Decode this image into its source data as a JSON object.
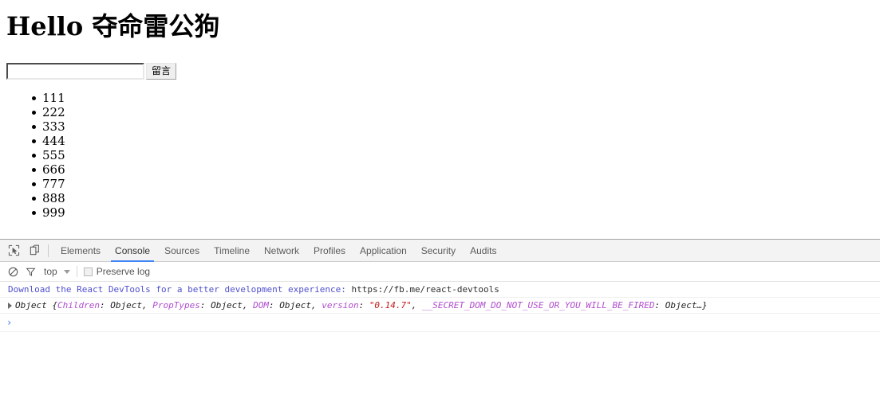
{
  "page": {
    "heading": "Hello 夺命雷公狗",
    "form": {
      "input_value": "",
      "input_placeholder": "",
      "submit_label": "留言"
    },
    "list_items": [
      "111",
      "222",
      "333",
      "444",
      "555",
      "666",
      "777",
      "888",
      "999"
    ]
  },
  "devtools": {
    "toolbar_icons": [
      {
        "name": "inspect-element-icon",
        "title": "Inspect element"
      },
      {
        "name": "device-toolbar-icon",
        "title": "Toggle device toolbar"
      }
    ],
    "tabs": [
      {
        "label": "Elements",
        "active": false
      },
      {
        "label": "Console",
        "active": true
      },
      {
        "label": "Sources",
        "active": false
      },
      {
        "label": "Timeline",
        "active": false
      },
      {
        "label": "Network",
        "active": false
      },
      {
        "label": "Profiles",
        "active": false
      },
      {
        "label": "Application",
        "active": false
      },
      {
        "label": "Security",
        "active": false
      },
      {
        "label": "Audits",
        "active": false
      }
    ],
    "active_tab": "Console",
    "filter_bar": {
      "clear_console_icon": "clear-console-icon",
      "filter_icon": "filter-icon",
      "context": "top",
      "preserve_log_label": "Preserve log",
      "preserve_log_checked": false
    },
    "console": {
      "messages": [
        {
          "type": "info",
          "text": "Download the React DevTools for a better development experience: ",
          "url": "https://fb.me/react-devtools"
        }
      ],
      "object_row": {
        "prefix": "Object ",
        "open_brace": "{",
        "entries": [
          {
            "key": "Children",
            "sep": ": ",
            "value": "Object",
            "value_kind": "object",
            "after": ", "
          },
          {
            "key": "PropTypes",
            "sep": ": ",
            "value": "Object",
            "value_kind": "object",
            "after": ", "
          },
          {
            "key": "DOM",
            "sep": ": ",
            "value": "Object",
            "value_kind": "object",
            "after": ", "
          },
          {
            "key": "version",
            "sep": ": ",
            "value": "\"0.14.7\"",
            "value_kind": "string",
            "after": ", "
          },
          {
            "key": "__SECRET_DOM_DO_NOT_USE_OR_YOU_WILL_BE_FIRED",
            "sep": ": ",
            "value": "Object…}",
            "value_kind": "object",
            "after": ""
          }
        ]
      },
      "prompt_symbol": "›"
    }
  },
  "colors": {
    "accent": "#4285f4",
    "info_text": "#5050d0",
    "prop_name": "#b14dcf",
    "string_value": "#c41a16",
    "toolbar_bg": "#f3f3f3"
  }
}
